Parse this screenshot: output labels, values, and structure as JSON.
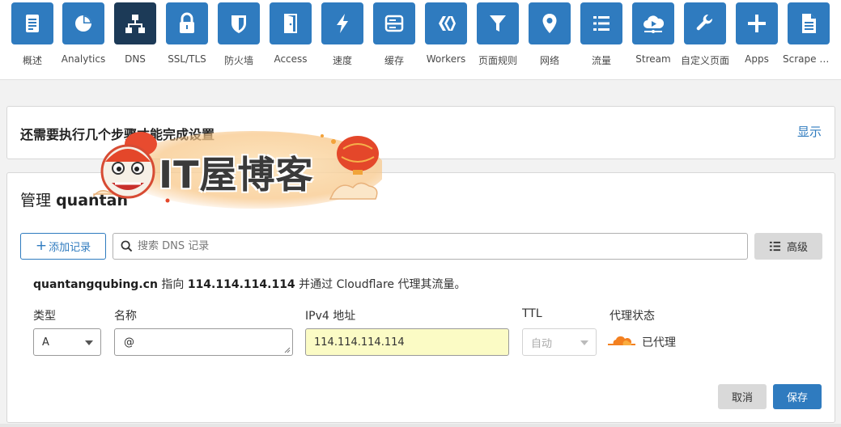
{
  "nav": {
    "items": [
      {
        "label": "概述",
        "icon": "document-icon"
      },
      {
        "label": "Analytics",
        "icon": "pie-chart-icon"
      },
      {
        "label": "DNS",
        "icon": "network-icon",
        "active": true
      },
      {
        "label": "SSL/TLS",
        "icon": "lock-icon"
      },
      {
        "label": "防火墙",
        "icon": "shield-icon"
      },
      {
        "label": "Access",
        "icon": "door-icon"
      },
      {
        "label": "速度",
        "icon": "lightning-icon"
      },
      {
        "label": "缓存",
        "icon": "server-icon"
      },
      {
        "label": "Workers",
        "icon": "workers-icon"
      },
      {
        "label": "页面规则",
        "icon": "filter-icon"
      },
      {
        "label": "网络",
        "icon": "location-pin-icon"
      },
      {
        "label": "流量",
        "icon": "list-icon"
      },
      {
        "label": "Stream",
        "icon": "cloud-play-icon"
      },
      {
        "label": "自定义页面",
        "icon": "wrench-icon"
      },
      {
        "label": "Apps",
        "icon": "plus-icon"
      },
      {
        "label": "Scrape S...",
        "icon": "scrape-document-icon"
      }
    ]
  },
  "setup": {
    "title": "还需要执行几个步骤才能完成设置",
    "show_label": "显示"
  },
  "watermark": {
    "text": "IT屋博客"
  },
  "dns": {
    "manage_prefix": "管理",
    "manage_domain": "quantan",
    "add_record_label": "添加记录",
    "search_placeholder": "搜索 DNS 记录",
    "advanced_label": "高级",
    "info": {
      "domain": "quantangqubing.cn",
      "points_to": "指向",
      "ip": "114.114.114.114",
      "suffix": "并通过 Cloudflare 代理其流量。"
    },
    "labels": {
      "type": "类型",
      "name": "名称",
      "ipv4": "IPv4 地址",
      "ttl": "TTL",
      "proxy": "代理状态"
    },
    "values": {
      "type": "A",
      "name": "@",
      "ipv4": "114.114.114.114",
      "ttl": "自动",
      "proxy": "已代理"
    },
    "cancel_label": "取消",
    "save_label": "保存"
  },
  "colors": {
    "accent": "#2f7bbf",
    "nav_active": "#1c3a57",
    "ip_highlight": "#fbfbc5",
    "proxy_orange": "#f38020"
  }
}
